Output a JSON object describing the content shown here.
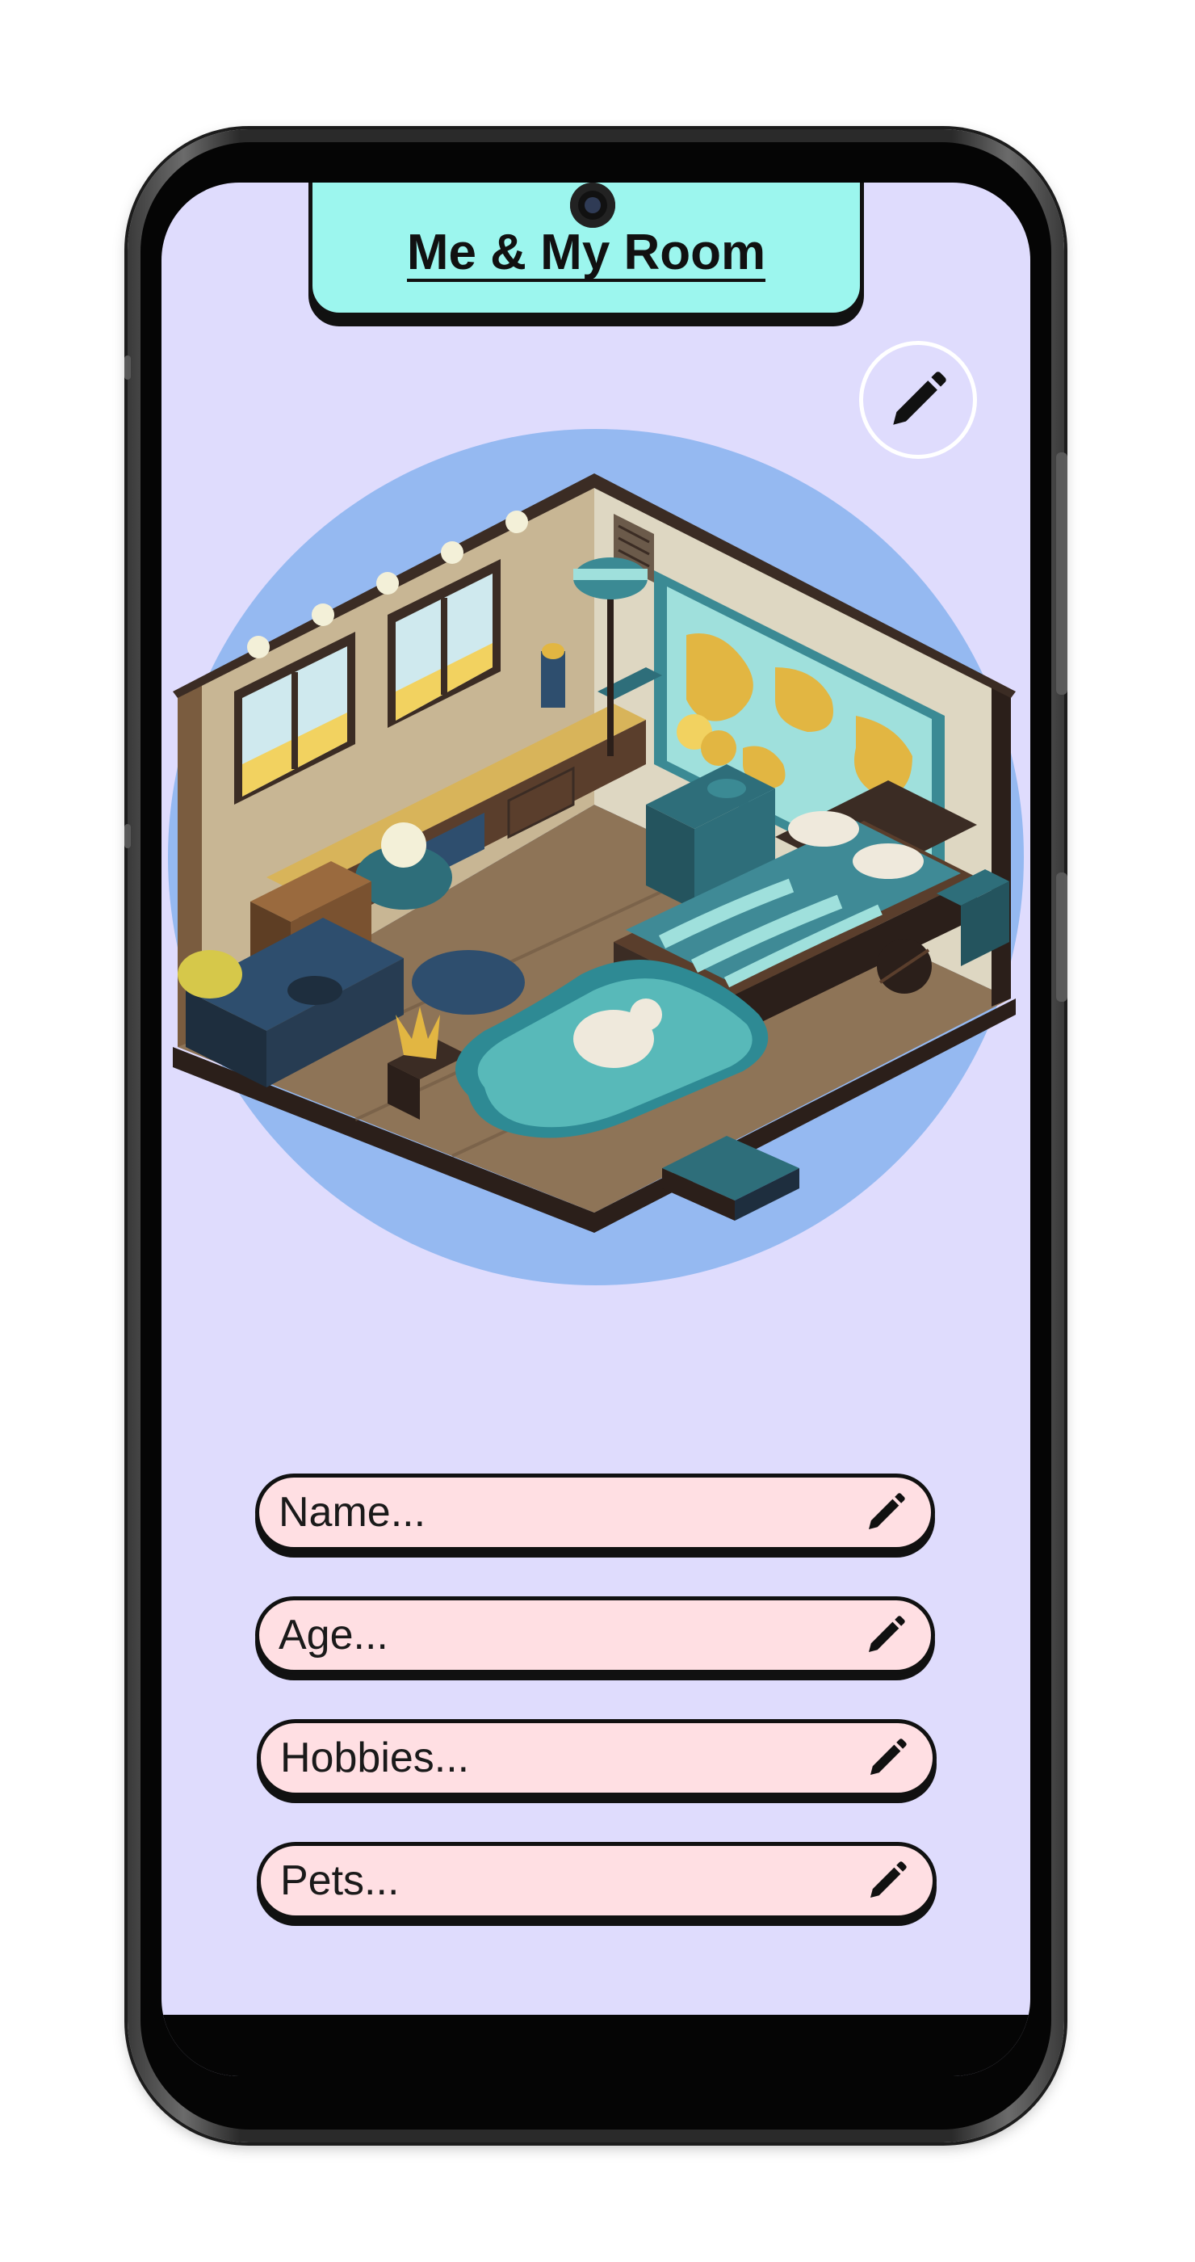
{
  "header": {
    "title": "Me & My Room"
  },
  "toolbar": {
    "edit_icon": "pencil-icon"
  },
  "profile_fields": [
    {
      "placeholder": "Name..."
    },
    {
      "placeholder": "Age..."
    },
    {
      "placeholder": "Hobbies..."
    },
    {
      "placeholder": "Pets..."
    }
  ],
  "colors": {
    "screen_background": "#dfdcfd",
    "title_tab": "#9cf6ee",
    "field_background": "#ffdfe3",
    "illustration_circle": "#95b9f1"
  }
}
